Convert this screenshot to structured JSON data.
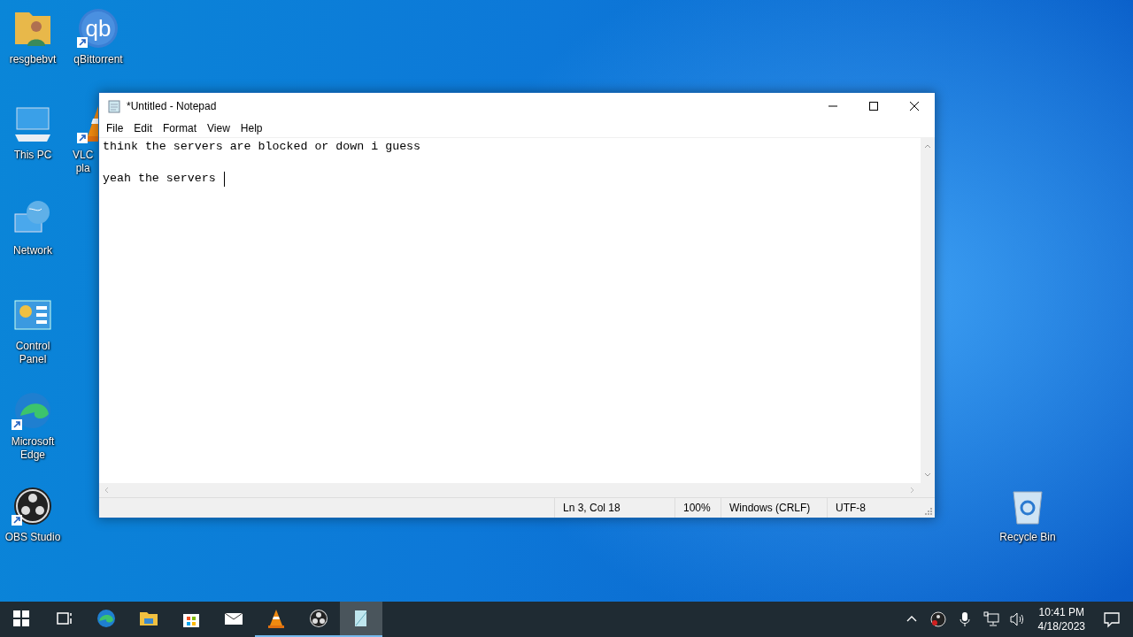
{
  "desktop_icons": [
    {
      "kind": "user-folder",
      "lines": [
        "resgbebvt"
      ],
      "shortcut": false
    },
    {
      "kind": "qbittorrent",
      "lines": [
        "qBittorrent"
      ],
      "shortcut": true,
      "glyph": "qb"
    },
    {
      "kind": "computer",
      "lines": [
        "This PC"
      ],
      "shortcut": false
    },
    {
      "kind": "cone",
      "lines": [
        "VLC",
        "pla"
      ],
      "shortcut": true
    },
    {
      "kind": "network",
      "lines": [
        "Network"
      ],
      "shortcut": false
    },
    {
      "kind": "control-panel",
      "lines": [
        "Control",
        "Panel"
      ],
      "shortcut": false
    },
    {
      "kind": "edge",
      "lines": [
        "Microsoft",
        "Edge"
      ],
      "shortcut": true
    },
    {
      "kind": "obs",
      "lines": [
        "OBS Studio"
      ],
      "shortcut": true
    },
    {
      "kind": "recycle-bin",
      "lines": [
        "Recycle Bin"
      ],
      "shortcut": false
    }
  ],
  "window": {
    "title": "*Untitled - Notepad",
    "menu": [
      "File",
      "Edit",
      "Format",
      "View",
      "Help"
    ],
    "paragraphs": [
      [
        "think the servers are blocked or down i guess"
      ],
      [
        "yeah the servers"
      ]
    ],
    "status_bar": [
      "Ln 3, Col 18",
      "100%",
      "Windows (CRLF)",
      "UTF-8"
    ]
  },
  "taskbar": {
    "items": [
      {
        "kind": "start",
        "running": false,
        "selected": false
      },
      {
        "kind": "task-view",
        "running": false,
        "selected": false
      },
      {
        "kind": "edge",
        "running": false,
        "selected": false
      },
      {
        "kind": "explorer",
        "running": false,
        "selected": false
      },
      {
        "kind": "store",
        "running": false,
        "selected": false
      },
      {
        "kind": "mail",
        "running": false,
        "selected": false
      },
      {
        "kind": "cone",
        "running": true,
        "selected": false
      },
      {
        "kind": "obs",
        "running": true,
        "selected": false
      },
      {
        "kind": "notepad",
        "running": true,
        "selected": true
      }
    ],
    "tray": [
      {
        "kind": "chevron"
      },
      {
        "kind": "obs"
      },
      {
        "kind": "microphone"
      },
      {
        "kind": "network"
      },
      {
        "kind": "volume"
      }
    ],
    "time": "10:41 PM",
    "date": "4/18/2023"
  }
}
